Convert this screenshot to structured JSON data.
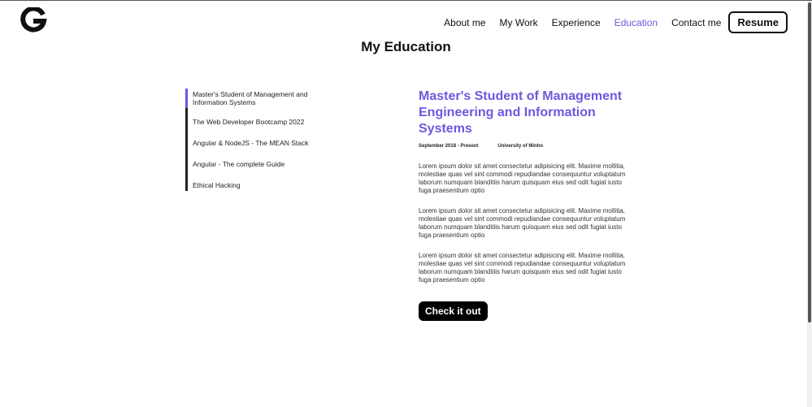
{
  "brand": {
    "logo_icon": "g-logo-icon"
  },
  "nav": {
    "links": [
      "About me",
      "My Work",
      "Experience",
      "Education",
      "Contact me"
    ],
    "active": "Education",
    "resume_label": "Resume"
  },
  "page": {
    "title": "My Education"
  },
  "tabs": [
    "Master's Student of Management and Information Systems",
    "The Web Developer Bootcamp 2022",
    "Angular & NodeJS - The MEAN Stack",
    "Angular - The complete Guide",
    "Ethical Hacking"
  ],
  "detail": {
    "title": "Master's Student of Management Engineering and Information Systems",
    "dates": "September 2018 - Present",
    "school": "University of Minho",
    "paragraphs": [
      "Lorem ipsum dolor sit amet consectetur adipisicing elit. Maxime mollitia, molestiae quas vel sint commodi repudiandae consequuntur voluptatum laborum numquam blanditiis harum quisquam eius sed odit fugiat iusto fuga praesentium optio",
      "Lorem ipsum dolor sit amet consectetur adipisicing elit. Maxime mollitia, molestiae quas vel sint commodi repudiandae consequuntur voluptatum laborum numquam blanditiis harum quisquam eius sed odit fugiat iusto fuga praesentium optio",
      "Lorem ipsum dolor sit amet consectetur adipisicing elit. Maxime mollitia, molestiae quas vel sint commodi repudiandae consequuntur voluptatum laborum numquam blanditiis harum quisquam eius sed odit fugiat iusto fuga praesentium optio"
    ],
    "cta_label": "Check it out"
  },
  "colors": {
    "accent": "#6a5ae0",
    "text": "#111111",
    "button": "#000000"
  }
}
